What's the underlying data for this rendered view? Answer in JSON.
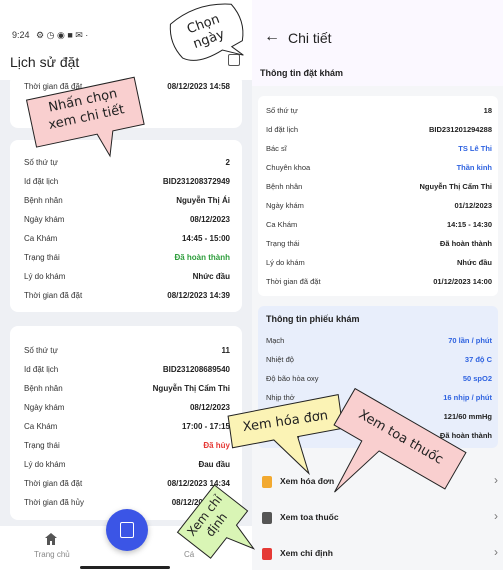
{
  "status_bar": {
    "time": "9:24",
    "icons": "⚙ ◷ ◉ ■ ✉ ·"
  },
  "left_screen": {
    "title": "Lịch sử đặt",
    "card0": {
      "label": "Thời gian đã đặt",
      "value": "08/12/2023 14:58"
    },
    "card1": {
      "rows": [
        {
          "label": "Số thứ tự",
          "value": "2"
        },
        {
          "label": "Id đặt lịch",
          "value": "BID231208372949"
        },
        {
          "label": "Bệnh nhân",
          "value": "Nguyễn Thị Ái"
        },
        {
          "label": "Ngày khám",
          "value": "08/12/2023"
        },
        {
          "label": "Ca Khám",
          "value": "14:45 - 15:00"
        },
        {
          "label": "Trạng thái",
          "value": "Đã hoàn thành"
        },
        {
          "label": "Lý do khám",
          "value": "Nhức đầu"
        },
        {
          "label": "Thời gian đã đặt",
          "value": "08/12/2023 14:39"
        }
      ]
    },
    "card2": {
      "rows": [
        {
          "label": "Số thứ tự",
          "value": "11"
        },
        {
          "label": "Id đặt lịch",
          "value": "BID231208689540"
        },
        {
          "label": "Bệnh nhân",
          "value": "Nguyễn Thị Cẩm Thi"
        },
        {
          "label": "Ngày khám",
          "value": "08/12/2023"
        },
        {
          "label": "Ca Khám",
          "value": "17:00 - 17:15"
        },
        {
          "label": "Trạng thái",
          "value": "Đã hủy"
        },
        {
          "label": "Lý do khám",
          "value": "Đau đầu"
        },
        {
          "label": "Thời gian đã đặt",
          "value": "08/12/2023 14:34"
        },
        {
          "label": "Thời gian đã hủy",
          "value": "08/12/2023 14:3"
        }
      ]
    },
    "bottom_nav": {
      "home_label": "Trang chủ",
      "right_label": "Cá"
    }
  },
  "right_screen": {
    "title": "Chi tiết",
    "booking_section": {
      "title": "Thông tin đặt khám",
      "rows": [
        {
          "label": "Số thứ tự",
          "value": "18"
        },
        {
          "label": "Id đặt lịch",
          "value": "BID231201294288"
        },
        {
          "label": "Bác sĩ",
          "value": "TS Lê Thi"
        },
        {
          "label": "Chuyên khoa",
          "value": "Thần kinh"
        },
        {
          "label": "Bệnh nhân",
          "value": "Nguyễn Thị Cẩm Thi"
        },
        {
          "label": "Ngày khám",
          "value": "01/12/2023"
        },
        {
          "label": "Ca Khám",
          "value": "14:15 - 14:30"
        },
        {
          "label": "Trạng thái",
          "value": "Đã hoàn thành"
        },
        {
          "label": "Lý do khám",
          "value": "Nhức đầu"
        },
        {
          "label": "Thời gian đã đặt",
          "value": "01/12/2023 14:00"
        }
      ]
    },
    "exam_section": {
      "title": "Thông tin phiếu khám",
      "rows": [
        {
          "label": "Mạch",
          "value": "70 lần / phút"
        },
        {
          "label": "Nhiệt độ",
          "value": "37 độ C"
        },
        {
          "label": "Độ bão hòa oxy",
          "value": "50 spO2"
        },
        {
          "label": "Nhịp thở",
          "value": "16 nhịp / phút"
        },
        {
          "label": "Huyết áp",
          "value": "121/60 mmHg"
        },
        {
          "label": "Trạng thái",
          "value": "Đã hoàn thành"
        }
      ]
    },
    "actions": [
      {
        "label": "Xem hóa đơn",
        "icon": "invoice-icon"
      },
      {
        "label": "Xem toa thuốc",
        "icon": "prescription-icon"
      },
      {
        "label": "Xem chỉ định",
        "icon": "order-icon"
      }
    ]
  },
  "callouts": {
    "select_date": {
      "line1": "Chọn",
      "line2": "ngày"
    },
    "select_detail": {
      "line1": "Nhấn chọn",
      "line2": "xem chi tiết"
    },
    "invoice": "Xem hóa đơn",
    "prescription": "Xem toa thuốc",
    "order": {
      "line1": "Xem chỉ",
      "line2": "định"
    }
  },
  "colors": {
    "accent_blue": "#2f63e0",
    "status_green": "#2e9e3c",
    "status_red": "#e53935",
    "fab": "#3b55e6",
    "callout_pink": "#f9cfcf",
    "callout_yellow": "#fbf3b5",
    "callout_green": "#d9f5b5"
  }
}
